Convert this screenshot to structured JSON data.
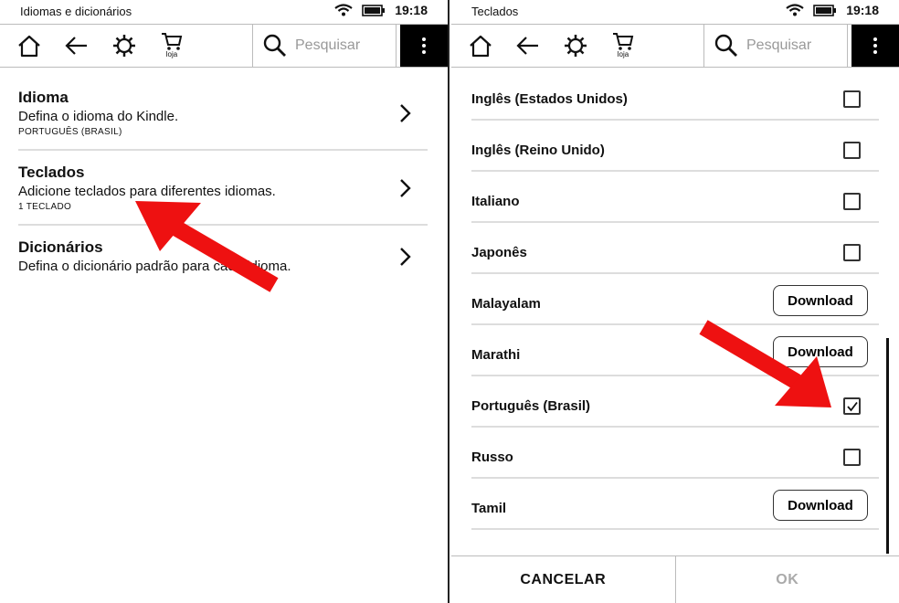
{
  "left_screen": {
    "status": {
      "title": "Idiomas e dicionários",
      "time": "19:18"
    },
    "toolbar": {
      "search_placeholder": "Pesquisar",
      "cart_label": "loja"
    },
    "settings": [
      {
        "title": "Idioma",
        "desc": "Defina o idioma do Kindle.",
        "sub": "PORTUGUÊS (BRASIL)"
      },
      {
        "title": "Teclados",
        "desc": "Adicione teclados para diferentes idiomas.",
        "sub": "1 TECLADO"
      },
      {
        "title": "Dicionários",
        "desc": "Defina o dicionário padrão para cada idioma.",
        "sub": ""
      }
    ]
  },
  "right_screen": {
    "status": {
      "title": "Teclados",
      "time": "19:18"
    },
    "toolbar": {
      "search_placeholder": "Pesquisar",
      "cart_label": "loja"
    },
    "keyboards": [
      {
        "label": "Inglês (Estados Unidos)",
        "control": "checkbox",
        "checked": false
      },
      {
        "label": "Inglês (Reino Unido)",
        "control": "checkbox",
        "checked": false
      },
      {
        "label": "Italiano",
        "control": "checkbox",
        "checked": false
      },
      {
        "label": "Japonês",
        "control": "checkbox",
        "checked": false
      },
      {
        "label": "Malayalam",
        "control": "download",
        "button_label": "Download"
      },
      {
        "label": "Marathi",
        "control": "download",
        "button_label": "Download"
      },
      {
        "label": "Português (Brasil)",
        "control": "checkbox",
        "checked": true
      },
      {
        "label": "Russo",
        "control": "checkbox",
        "checked": false
      },
      {
        "label": "Tamil",
        "control": "download",
        "button_label": "Download"
      }
    ],
    "bottom": {
      "cancel_label": "CANCELAR",
      "ok_label": "OK"
    }
  },
  "colors": {
    "annotation_arrow": "#ee1111",
    "menu_bg": "#000000"
  },
  "icons": [
    "home-icon",
    "back-icon",
    "settings-icon",
    "cart-icon",
    "search-icon",
    "menu-icon",
    "chevron-right-icon",
    "wifi-icon",
    "battery-icon",
    "checkmark-icon"
  ]
}
